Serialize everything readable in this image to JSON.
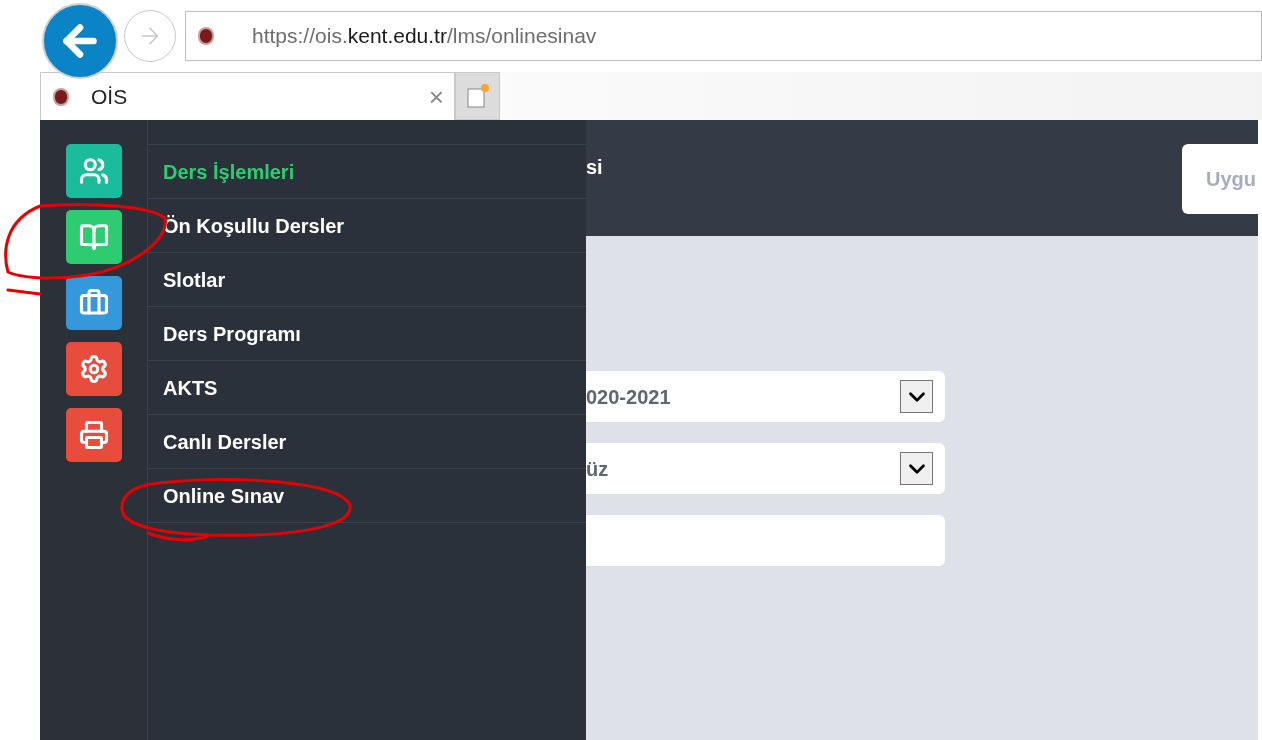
{
  "browser": {
    "url": {
      "scheme": "https://ois.",
      "domain": "kent.edu.tr",
      "path": "/lms/onlinesinav"
    },
    "tab": {
      "title": "OİS",
      "close": "×"
    }
  },
  "sidebar": {
    "items": [
      {
        "kind": "users",
        "color": "#1abc9c"
      },
      {
        "kind": "book",
        "color": "#2ecc71"
      },
      {
        "kind": "briefcase",
        "color": "#3498db"
      },
      {
        "kind": "gear",
        "color": "#e74c3c"
      },
      {
        "kind": "printer",
        "color": "#e74c3c"
      }
    ]
  },
  "menu": {
    "items": [
      {
        "kind": "heading",
        "label": "Ders İşlemleri"
      },
      {
        "kind": "link",
        "label": "Ön Koşullu Dersler"
      },
      {
        "kind": "link",
        "label": "Slotlar"
      },
      {
        "kind": "link",
        "label": "Ders Programı"
      },
      {
        "kind": "link",
        "label": "AKTS"
      },
      {
        "kind": "link",
        "label": "Canlı Dersler"
      },
      {
        "kind": "link",
        "label": "Online Sınav"
      }
    ]
  },
  "header": {
    "title": "si",
    "button": "Uygu"
  },
  "form": {
    "fields": [
      {
        "kind": "select",
        "value": "020-2021"
      },
      {
        "kind": "select",
        "value": "üz"
      },
      {
        "kind": "text"
      }
    ]
  },
  "annotations": [
    {
      "kind": "circle"
    },
    {
      "kind": "circle"
    }
  ]
}
